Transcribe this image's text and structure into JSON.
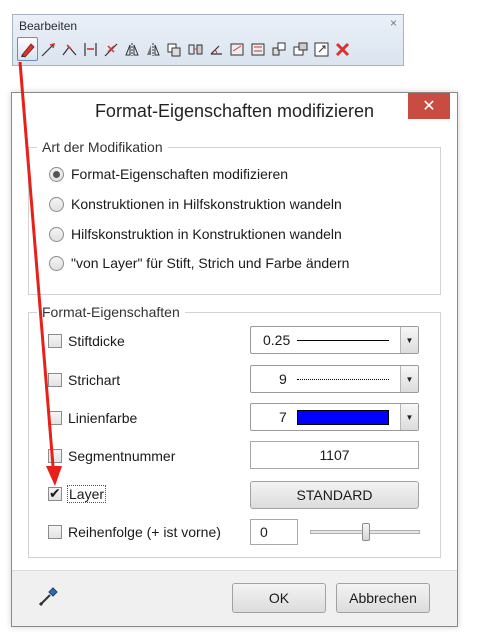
{
  "toolbar": {
    "title": "Bearbeiten",
    "close_glyph": "×",
    "icons": [
      "pencil-modify-icon",
      "line-edit-icon",
      "line-split-icon",
      "line-trim-icon",
      "line-delete-segment-icon",
      "mirror-icon",
      "mirror-copy-icon",
      "copy-icon",
      "move-icon",
      "rotate-icon",
      "modify-length-icon",
      "modify-parallel-icon",
      "stretch-icon",
      "move-elements-icon",
      "scale-icon",
      "delete-icon"
    ]
  },
  "dialog": {
    "title": "Format-Eigenschaften modifizieren",
    "close_glyph": "✕",
    "modification_group": {
      "label": "Art der Modifikation",
      "options": [
        {
          "label": "Format-Eigenschaften modifizieren",
          "checked": true
        },
        {
          "label": "Konstruktionen in Hilfskonstruktion wandeln",
          "checked": false
        },
        {
          "label": "Hilfskonstruktion in Konstruktionen wandeln",
          "checked": false
        },
        {
          "label": "\"von Layer\" für Stift, Strich und Farbe ändern",
          "checked": false
        }
      ]
    },
    "format_group": {
      "label": "Format-Eigenschaften",
      "stiftdicke": {
        "label": "Stiftdicke",
        "checked": false,
        "value": "0.25"
      },
      "strichart": {
        "label": "Strichart",
        "checked": false,
        "value": "9"
      },
      "linienfarbe": {
        "label": "Linienfarbe",
        "checked": false,
        "value": "7",
        "color": "#0000ff"
      },
      "segmentnummer": {
        "label": "Segmentnummer",
        "checked": false,
        "value": "1107"
      },
      "layer": {
        "label": "Layer",
        "checked": true,
        "button": "STANDARD"
      },
      "reihenfolge": {
        "label": "Reihenfolge (+ ist vorne)",
        "checked": false,
        "value": "0",
        "slider_fraction": 0.5
      }
    },
    "buttons": {
      "ok": "OK",
      "cancel": "Abbrechen"
    }
  },
  "colors": {
    "annotation_arrow": "#e8201a",
    "close_button": "#c94c42",
    "swatch": "#0000ff"
  }
}
